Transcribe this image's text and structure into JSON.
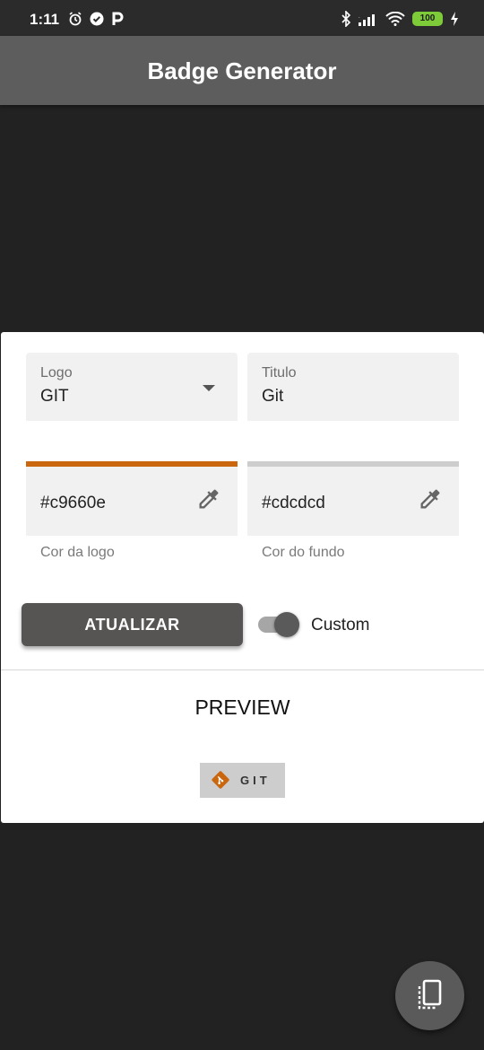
{
  "status_bar": {
    "time": "1:11",
    "battery": "100",
    "left_icons": [
      "alarm-icon",
      "check-circle-icon",
      "parking-icon"
    ],
    "right_icons": [
      "bluetooth-icon",
      "signal-icon",
      "wifi-icon",
      "battery-icon",
      "charging-icon"
    ]
  },
  "app_bar": {
    "title": "Badge Generator"
  },
  "form": {
    "logo_label": "Logo",
    "logo_value": "GIT",
    "titulo_label": "Titulo",
    "titulo_value": "Git",
    "logo_color": {
      "value": "#c9660e",
      "helper": "Cor da logo",
      "color": "#c9660e"
    },
    "bg_color": {
      "value": "#cdcdcd",
      "helper": "Cor do fundo",
      "color": "#cdcdcd"
    },
    "update_button": "ATUALIZAR",
    "custom_switch": {
      "label": "Custom",
      "on": true
    }
  },
  "preview": {
    "title": "PREVIEW",
    "badge_text": "GIT",
    "badge_bg": "#cdcdcd",
    "badge_logo_color": "#c9660e"
  },
  "fab": {
    "icon": "device-copy-icon"
  },
  "colors": {
    "background": "#222222",
    "app_bar": "#5d5d5d",
    "accent": "#c9660e"
  }
}
